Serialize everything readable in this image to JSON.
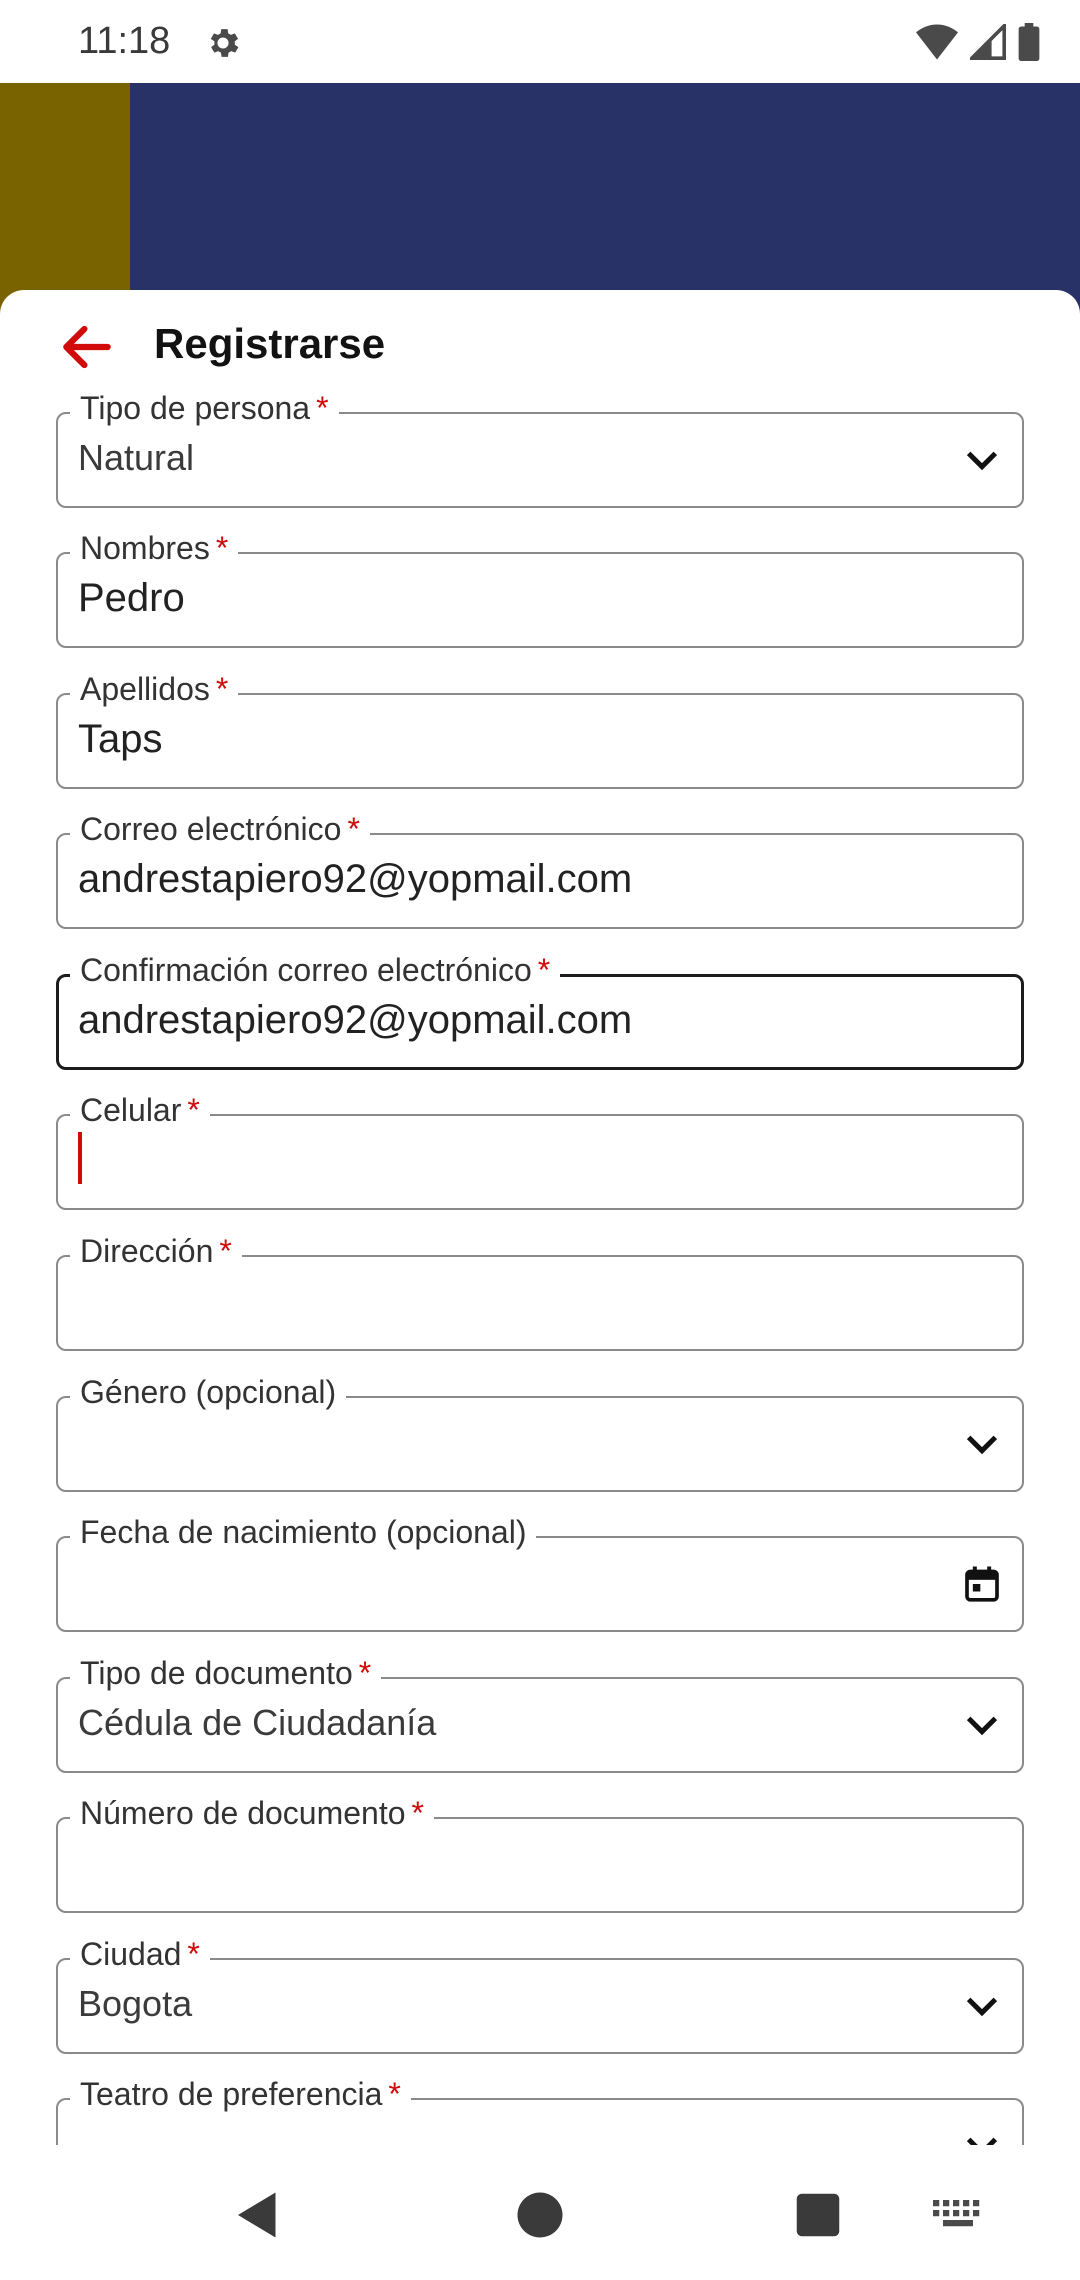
{
  "status_bar": {
    "time": "11:18",
    "icons": [
      "gear-icon",
      "wifi-icon",
      "signal-icon",
      "battery-icon"
    ]
  },
  "header": {
    "title": "Registrarse",
    "back_icon": "arrow-left-icon",
    "accent_color": "#d10a0a"
  },
  "colors": {
    "brand_olive": "#786300",
    "brand_navy": "#283266"
  },
  "form": {
    "fields": [
      {
        "label": "Tipo de persona",
        "required": "*",
        "value": "Natural",
        "type": "select"
      },
      {
        "label": "Nombres",
        "required": "*",
        "value": "Pedro",
        "type": "text"
      },
      {
        "label": "Apellidos",
        "required": "*",
        "value": "Taps",
        "type": "text"
      },
      {
        "label": "Correo electrónico",
        "required": "*",
        "value": "andrestapiero92@yopmail.com",
        "type": "text"
      },
      {
        "label": "Confirmación correo electrónico",
        "required": "*",
        "value": "andrestapiero92@yopmail.com",
        "type": "text"
      },
      {
        "label": "Celular",
        "required": "*",
        "value": "",
        "type": "text"
      },
      {
        "label": "Dirección",
        "required": "*",
        "value": "",
        "type": "text"
      },
      {
        "label": "Género (opcional)",
        "required": "",
        "value": "",
        "type": "select"
      },
      {
        "label": "Fecha de nacimiento (opcional)",
        "required": "",
        "value": "",
        "type": "date"
      },
      {
        "label": "Tipo de documento",
        "required": "*",
        "value": "Cédula de Ciudadanía",
        "type": "select"
      },
      {
        "label": "Número de documento",
        "required": "*",
        "value": "",
        "type": "text"
      },
      {
        "label": "Ciudad",
        "required": "*",
        "value": "Bogota",
        "type": "select"
      },
      {
        "label": "Teatro de preferencia",
        "required": "*",
        "value": "",
        "type": "select"
      }
    ]
  },
  "nav_bar": {
    "icons": [
      "back-triangle-icon",
      "home-circle-icon",
      "recents-square-icon",
      "keyboard-icon"
    ]
  }
}
